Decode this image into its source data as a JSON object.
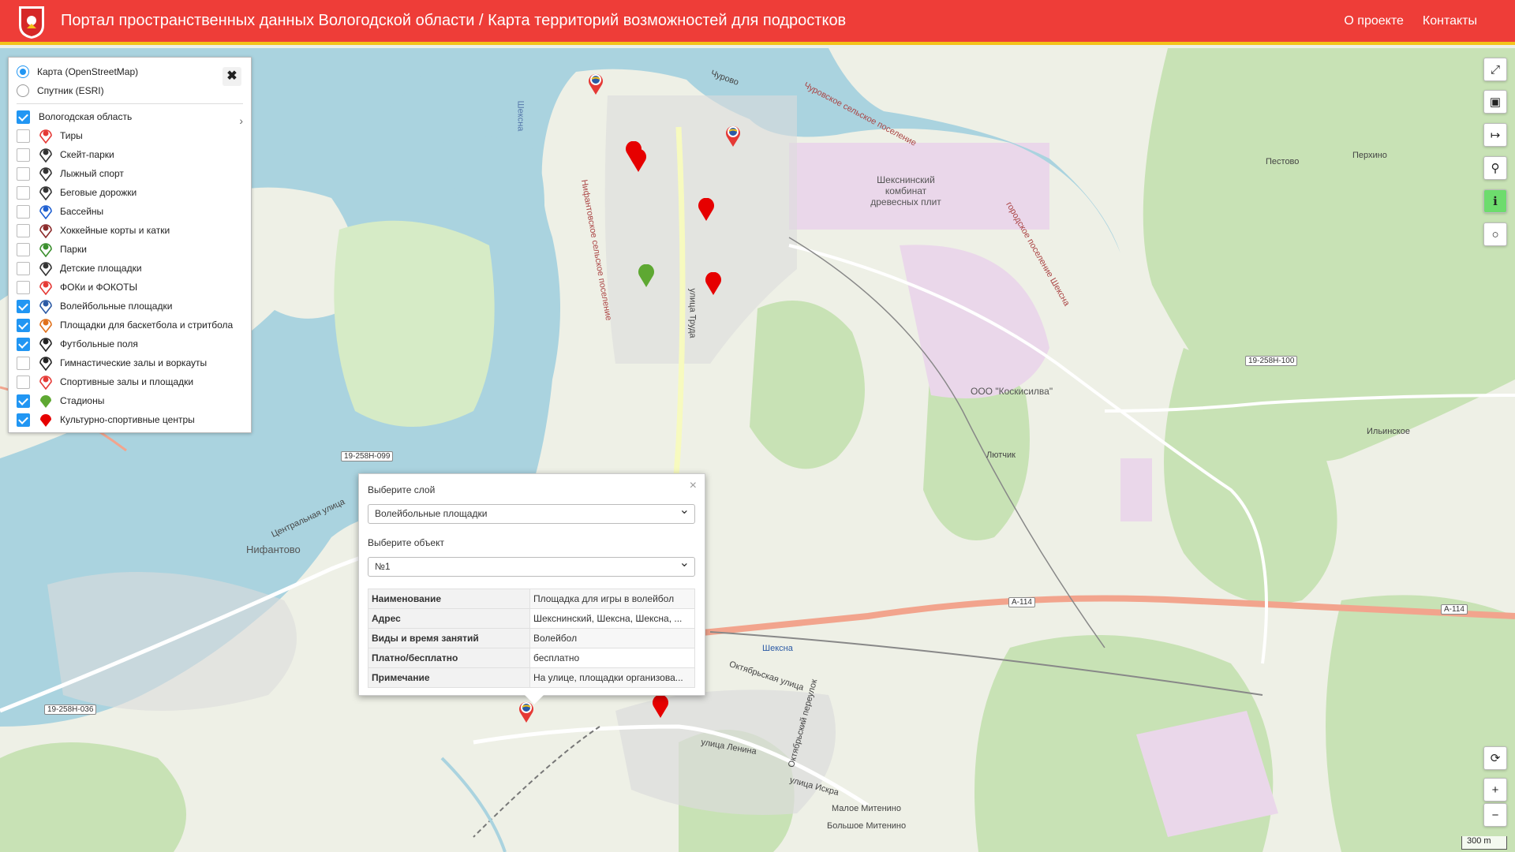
{
  "header": {
    "title": "Портал пространственных данных Вологодской области / Карта территорий возможностей для подростков",
    "nav": [
      "О проекте",
      "Контакты"
    ],
    "color": "#ee3d38",
    "stripe_color": "#f4c21a"
  },
  "basemaps": [
    {
      "label": "Карта (OpenStreetMap)",
      "selected": true
    },
    {
      "label": "Спутник (ESRI)",
      "selected": false
    }
  ],
  "region": {
    "label": "Вологодская область",
    "checked": true
  },
  "layers": [
    {
      "label": "Тиры",
      "checked": false,
      "icon": "shooting-range-icon"
    },
    {
      "label": "Скейт-парки",
      "checked": false,
      "icon": "skatepark-icon"
    },
    {
      "label": "Лыжный спорт",
      "checked": false,
      "icon": "ski-icon"
    },
    {
      "label": "Беговые дорожки",
      "checked": false,
      "icon": "running-track-icon"
    },
    {
      "label": "Бассейны",
      "checked": false,
      "icon": "pool-icon"
    },
    {
      "label": "Хоккейные корты и катки",
      "checked": false,
      "icon": "hockey-icon"
    },
    {
      "label": "Парки",
      "checked": false,
      "icon": "park-icon"
    },
    {
      "label": "Детские площадки",
      "checked": false,
      "icon": "playground-icon"
    },
    {
      "label": "ФОКи и ФОКОТЫ",
      "checked": false,
      "icon": "sports-complex-icon"
    },
    {
      "label": "Волейбольные площадки",
      "checked": true,
      "icon": "volleyball-icon"
    },
    {
      "label": "Площадки для баскетбола и стритбола",
      "checked": true,
      "icon": "basketball-icon"
    },
    {
      "label": "Футбольные поля",
      "checked": true,
      "icon": "football-icon"
    },
    {
      "label": "Гимнастические залы и воркауты",
      "checked": false,
      "icon": "gym-icon"
    },
    {
      "label": "Спортивные залы и площадки",
      "checked": false,
      "icon": "sports-hall-icon"
    },
    {
      "label": "Стадионы",
      "checked": true,
      "icon": "stadium-icon"
    },
    {
      "label": "Культурно-спортивные центры",
      "checked": true,
      "icon": "culture-center-icon"
    }
  ],
  "popup": {
    "layer_label": "Выберите слой",
    "layer_value": "Волейбольные площадки",
    "object_label": "Выберите объект",
    "object_value": "№1",
    "rows": [
      {
        "key": "Наименование",
        "value": "Площадка для игры в волейбол"
      },
      {
        "key": "Адрес",
        "value": "Шекснинский, Шексна, Шексна, ..."
      },
      {
        "key": "Виды и время занятий",
        "value": "Волейбол"
      },
      {
        "key": "Платно/бесплатно",
        "value": "бесплатно"
      },
      {
        "key": "Примечание",
        "value": "На улице, площадки организова..."
      }
    ]
  },
  "controls": [
    "fullscreen-icon",
    "layers-panel-icon",
    "measure-icon",
    "locate-icon",
    "info-icon",
    "circle-icon",
    "refresh-icon",
    "zoom-in-icon",
    "zoom-out-icon"
  ],
  "map_labels": {
    "churovo": "Чурово",
    "churovo_sp": "Чуровское сельское поселение",
    "pestovo": "Пестово",
    "perkhino": "Перхино",
    "kombinat": "Шекснинский комбинат древесных плит",
    "sheksna_gp": "городское поселение Шексна",
    "koskisilva": "ООО \"Коскисилва\"",
    "lyutchik": "Лютчик",
    "ilinskoe": "Ильинское",
    "nifantovo": "Нифантово",
    "sheksna": "Шексна",
    "maloe_mitenino": "Малое Митенино",
    "bolshoe_mitenino": "Большое Митенино",
    "scale": "300 m",
    "roads": [
      "19-258Н-100",
      "19-258Н-099",
      "19-258Н-036",
      "А-114",
      "А-114"
    ],
    "streets": [
      "улица Труда",
      "Центральная улица",
      "Октябрьская улица",
      "улица Ленина",
      "улица Искра",
      "Октябрьский переулок"
    ],
    "river": "Шексна",
    "nifantovo_sp": "Нифантовское сельское поселение"
  }
}
